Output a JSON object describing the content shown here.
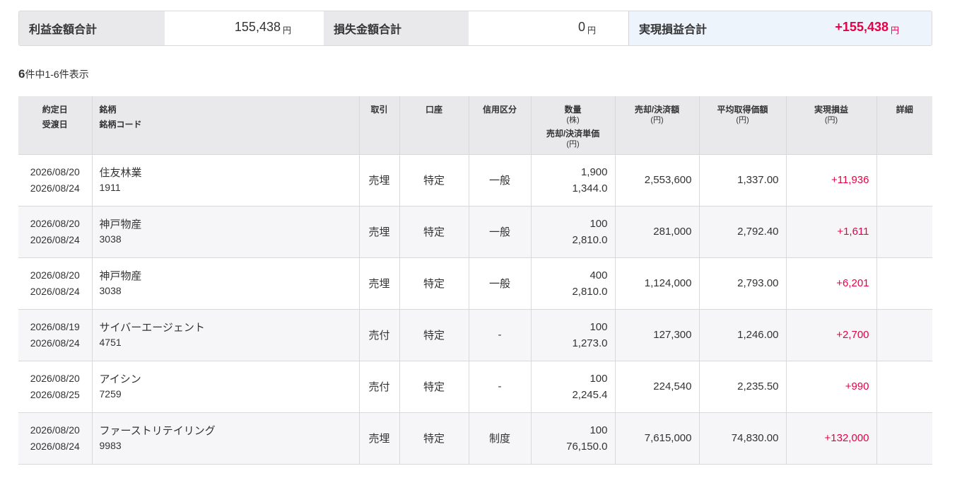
{
  "summary": {
    "profit_label": "利益金額合計",
    "profit_value": "155,438",
    "loss_label": "損失金額合計",
    "loss_value": "0",
    "total_label": "実現損益合計",
    "total_value": "+155,438",
    "unit": "円"
  },
  "count": {
    "total": "6",
    "text": "件中1-6件表示"
  },
  "table": {
    "headers": {
      "date_contract": "約定日",
      "date_delivery": "受渡日",
      "name": "銘柄",
      "code": "銘柄コード",
      "trade": "取引",
      "account": "口座",
      "credit": "信用区分",
      "qty": "数量",
      "qty_sub": "(株)",
      "price": "売却/決済単価",
      "price_sub": "(円)",
      "amount": "売却/決済額",
      "amount_sub": "(円)",
      "avg": "平均取得価額",
      "avg_sub": "(円)",
      "pl": "実現損益",
      "pl_sub": "(円)",
      "detail": "詳細"
    },
    "rows": [
      {
        "contract": "2026/08/20",
        "delivery": "2026/08/24",
        "name": "住友林業",
        "code": "1911",
        "trade": "売埋",
        "account": "特定",
        "credit": "一般",
        "qty": "1,900",
        "price": "1,344.0",
        "amount": "2,553,600",
        "avg": "1,337.00",
        "pl": "+11,936"
      },
      {
        "contract": "2026/08/20",
        "delivery": "2026/08/24",
        "name": "神戸物産",
        "code": "3038",
        "trade": "売埋",
        "account": "特定",
        "credit": "一般",
        "qty": "100",
        "price": "2,810.0",
        "amount": "281,000",
        "avg": "2,792.40",
        "pl": "+1,611"
      },
      {
        "contract": "2026/08/20",
        "delivery": "2026/08/24",
        "name": "神戸物産",
        "code": "3038",
        "trade": "売埋",
        "account": "特定",
        "credit": "一般",
        "qty": "400",
        "price": "2,810.0",
        "amount": "1,124,000",
        "avg": "2,793.00",
        "pl": "+6,201"
      },
      {
        "contract": "2026/08/19",
        "delivery": "2026/08/24",
        "name": "サイバーエージェント",
        "code": "4751",
        "trade": "売付",
        "account": "特定",
        "credit": "-",
        "qty": "100",
        "price": "1,273.0",
        "amount": "127,300",
        "avg": "1,246.00",
        "pl": "+2,700"
      },
      {
        "contract": "2026/08/20",
        "delivery": "2026/08/25",
        "name": "アイシン",
        "code": "7259",
        "trade": "売付",
        "account": "特定",
        "credit": "-",
        "qty": "100",
        "price": "2,245.4",
        "amount": "224,540",
        "avg": "2,235.50",
        "pl": "+990"
      },
      {
        "contract": "2026/08/20",
        "delivery": "2026/08/24",
        "name": "ファーストリテイリング",
        "code": "9983",
        "trade": "売埋",
        "account": "特定",
        "credit": "制度",
        "qty": "100",
        "price": "76,150.0",
        "amount": "7,615,000",
        "avg": "74,830.00",
        "pl": "+132,000"
      }
    ]
  },
  "colors": {
    "profit": "#e60045",
    "header_bg": "#e9e9ec",
    "total_bg": "#eef4fc"
  }
}
